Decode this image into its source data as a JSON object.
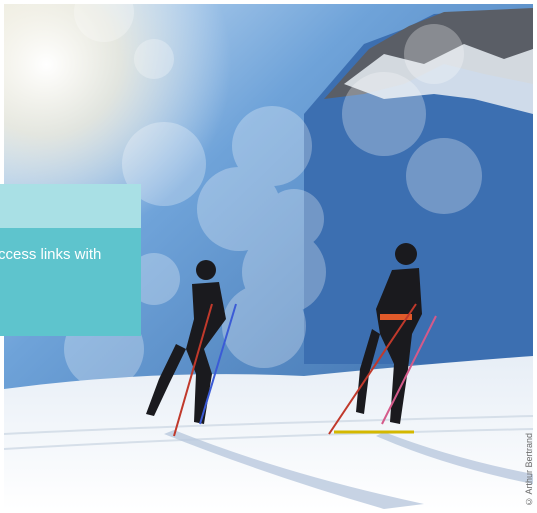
{
  "overlay": {
    "text": "ccess links with"
  },
  "photo": {
    "alt_icon": "photo-icon",
    "credit": "© Arthur Bertrand"
  },
  "colors": {
    "sky": "#4d86c7",
    "snow": "#f2f5fa",
    "panel": "#5ec4cd",
    "panel_strip": "#a9e0e5"
  }
}
